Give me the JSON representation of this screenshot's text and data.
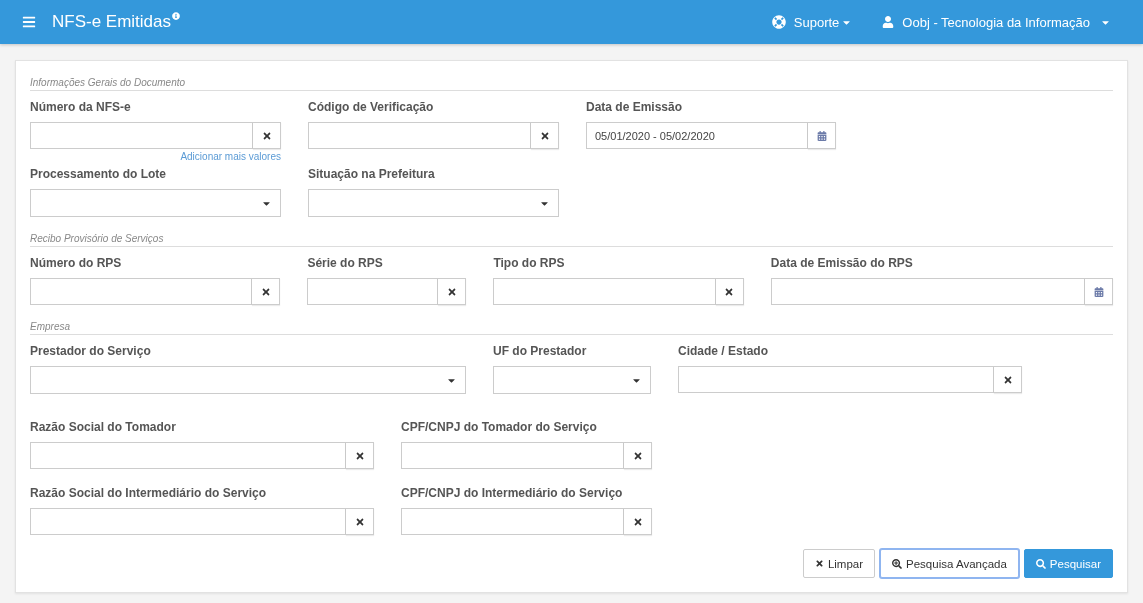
{
  "header": {
    "title": "NFS-e Emitidas",
    "support": "Suporte",
    "user": "Oobj - Tecnologia da Informação"
  },
  "sections": [
    {
      "title": "Informações Gerais do Documento",
      "rows": [
        [
          {
            "label": "Número da NFS-e",
            "kind": "clear",
            "helper": "Adicionar mais valores"
          },
          {
            "label": "Código de Verificação",
            "kind": "clear"
          },
          {
            "label": "Data de Emissão",
            "kind": "date",
            "value": "05/01/2020 - 05/02/2020"
          }
        ],
        [
          {
            "label": "Processamento do Lote",
            "kind": "select"
          },
          {
            "label": "Situação na Prefeitura",
            "kind": "select"
          }
        ]
      ]
    },
    {
      "title": "Recibo Provisório de Serviços",
      "rows": [
        [
          {
            "label": "Número do RPS",
            "kind": "clear"
          },
          {
            "label": "Série do RPS",
            "kind": "clear"
          },
          {
            "label": "Tipo do RPS",
            "kind": "clear"
          },
          {
            "label": "Data de Emissão do RPS",
            "kind": "date"
          }
        ]
      ]
    },
    {
      "title": "Empresa",
      "rows": [
        [
          {
            "label": "Prestador do Serviço",
            "kind": "select"
          },
          {
            "label": "UF do Prestador",
            "kind": "select"
          },
          {
            "label": "Cidade / Estado",
            "kind": "clear"
          }
        ],
        [
          {
            "label": "Razão Social do Tomador",
            "kind": "clear"
          },
          {
            "label": "CPF/CNPJ do Tomador do Serviço",
            "kind": "clear"
          }
        ],
        [
          {
            "label": "Razão Social do Intermediário do Serviço",
            "kind": "clear"
          },
          {
            "label": "CPF/CNPJ do Intermediário do Serviço",
            "kind": "clear"
          }
        ]
      ]
    }
  ],
  "buttons": [
    {
      "label": "Limpar",
      "kind": "clear",
      "focused": false
    },
    {
      "label": "Pesquisa Avançada",
      "kind": "advanced",
      "focused": true
    },
    {
      "label": "Pesquisar",
      "kind": "primary",
      "focused": false
    }
  ]
}
